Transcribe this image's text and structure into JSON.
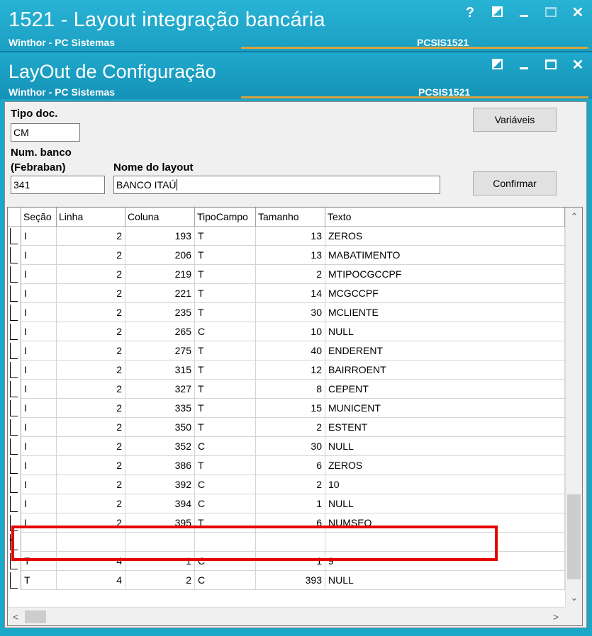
{
  "outer_window": {
    "title": "1521 - Layout integração bancária",
    "subtitle": "Winthor - PC Sistemas",
    "code": "PCSIS1521",
    "controls": {
      "help": "?",
      "minimize": "_",
      "close": "✕"
    }
  },
  "inner_window": {
    "title": "LayOut de Configuração",
    "subtitle": "Winthor - PC Sistemas",
    "code": "PCSIS1521",
    "controls": {
      "minimize": "_",
      "close": "✕"
    }
  },
  "form": {
    "tipo_doc_label": "Tipo doc.",
    "tipo_doc_value": "CM",
    "num_banco_label_1": "Num. banco",
    "num_banco_label_2": "(Febraban)",
    "num_banco_value": "341",
    "nome_layout_label": "Nome do layout",
    "nome_layout_value": "BANCO ITAÚ",
    "variaveis_button": "Variáveis",
    "confirmar_button": "Confirmar"
  },
  "grid": {
    "columns": [
      "Seção",
      "Linha",
      "Coluna",
      "TipoCampo",
      "Tamanho",
      "Texto"
    ],
    "rows": [
      [
        "I",
        "2",
        "193",
        "T",
        "13",
        "ZEROS"
      ],
      [
        "I",
        "2",
        "206",
        "T",
        "13",
        "MABATIMENTO"
      ],
      [
        "I",
        "2",
        "219",
        "T",
        "2",
        "MTIPOCGCCPF"
      ],
      [
        "I",
        "2",
        "221",
        "T",
        "14",
        "MCGCCPF"
      ],
      [
        "I",
        "2",
        "235",
        "T",
        "30",
        "MCLIENTE"
      ],
      [
        "I",
        "2",
        "265",
        "C",
        "10",
        "NULL"
      ],
      [
        "I",
        "2",
        "275",
        "T",
        "40",
        "ENDERENT"
      ],
      [
        "I",
        "2",
        "315",
        "T",
        "12",
        "BAIRROENT"
      ],
      [
        "I",
        "2",
        "327",
        "T",
        "8",
        "CEPENT"
      ],
      [
        "I",
        "2",
        "335",
        "T",
        "15",
        "MUNICENT"
      ],
      [
        "I",
        "2",
        "350",
        "T",
        "2",
        "ESTENT"
      ],
      [
        "I",
        "2",
        "352",
        "C",
        "30",
        "NULL"
      ],
      [
        "I",
        "2",
        "386",
        "T",
        "6",
        "ZEROS"
      ],
      [
        "I",
        "2",
        "392",
        "C",
        "2",
        "10"
      ],
      [
        "I",
        "2",
        "394",
        "C",
        "1",
        "NULL"
      ],
      [
        "I",
        "2",
        "395",
        "T",
        "6",
        "NUMSEQ"
      ],
      [
        "",
        "",
        "",
        "",
        "",
        ""
      ],
      [
        "T",
        "4",
        "1",
        "C",
        "1",
        "9"
      ],
      [
        "T",
        "4",
        "2",
        "C",
        "393",
        "NULL"
      ]
    ],
    "new_row_marker": "*",
    "scroll_up": "⌃",
    "scroll_down": "⌄",
    "scroll_left": "<",
    "scroll_right": ">"
  }
}
